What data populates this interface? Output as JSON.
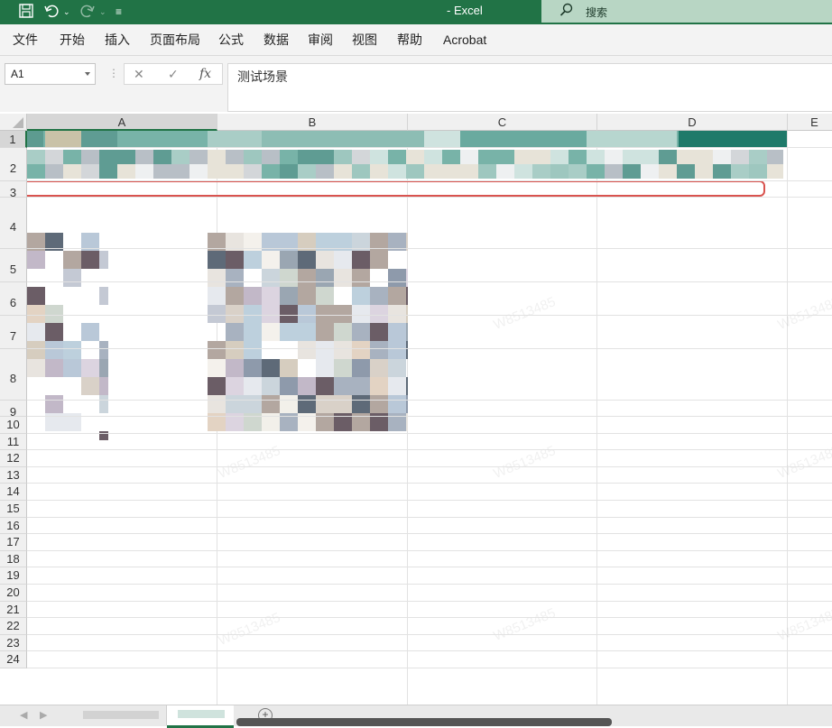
{
  "app": {
    "title": "- Excel",
    "search_label": "搜索"
  },
  "ribbon": {
    "tabs": [
      "文件",
      "开始",
      "插入",
      "页面布局",
      "公式",
      "数据",
      "审阅",
      "视图",
      "帮助",
      "Acrobat"
    ]
  },
  "formula_bar": {
    "name_box": "A1",
    "formula": "测试场景",
    "fx_label": "fx"
  },
  "grid": {
    "columns": [
      "A",
      "B",
      "C",
      "D",
      "E"
    ],
    "rows": [
      "1",
      "2",
      "3",
      "4",
      "5",
      "6",
      "7",
      "8",
      "9",
      "10",
      "11",
      "12",
      "13",
      "14",
      "15",
      "16",
      "17",
      "18",
      "19",
      "20",
      "21",
      "22",
      "23",
      "24"
    ],
    "highlighted_row": "3"
  },
  "watermark": "W8513485",
  "colors": {
    "excel_green": "#217346",
    "highlight_outline": "#d9534f",
    "header_fill": "#78b3a8"
  }
}
